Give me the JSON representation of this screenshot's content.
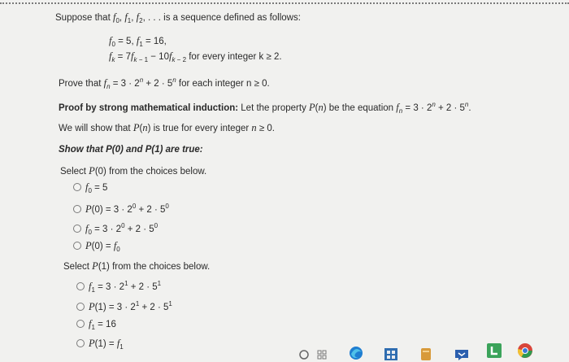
{
  "intro": {
    "prefix": "Suppose that ",
    "sequence_terms": "f0, f1, f2, . . .",
    "suffix": " is a sequence defined as follows:"
  },
  "definition": {
    "line1": "f0 = 5, f1 = 16,",
    "line2_formula": "fk = 7fk − 1 − 10fk − 2",
    "line2_condition": "for every integer k ≥ 2."
  },
  "prove": {
    "prefix": "Prove that ",
    "formula": "fn = 3 · 2n + 2 · 5n",
    "suffix": " for each integer n ≥ 0."
  },
  "proof": {
    "heading": "Proof by strong mathematical induction:",
    "text": " Let the property P(n) be the equation fn = 3 · 2n + 2 · 5n."
  },
  "show_all": "We will show that P(n) is true for every integer n ≥ 0.",
  "show_base": {
    "heading": "Show that P(0) and P(1) are true:"
  },
  "select_p0": {
    "label": "Select P(0) from the choices below.",
    "options": [
      "f0 = 5",
      "P(0) = 3 · 20 + 2 · 50",
      "f0 = 3 · 20 + 2 · 50",
      "P(0) = f0"
    ]
  },
  "select_p1": {
    "label": "Select P(1) from the choices below.",
    "options": [
      "f1 = 3 · 21 + 2 · 51",
      "P(1) = 3 · 21 + 2 · 51",
      "f1 = 16",
      "P(1) = f1"
    ]
  },
  "taskbar": {
    "icons": [
      "circle-icon",
      "grid-icon",
      "edge-browser-icon",
      "store-icon",
      "app-icon",
      "chat-icon",
      "l-app-icon",
      "chrome-icon"
    ],
    "colors": {
      "edge": "#1f7ed1",
      "store": "#2f6db0",
      "chat": "#2b5fae",
      "l_app": "#3ba35a",
      "chrome_red": "#d8453a",
      "chrome_green": "#2e9a4f",
      "chrome_yellow": "#f1c232"
    }
  }
}
